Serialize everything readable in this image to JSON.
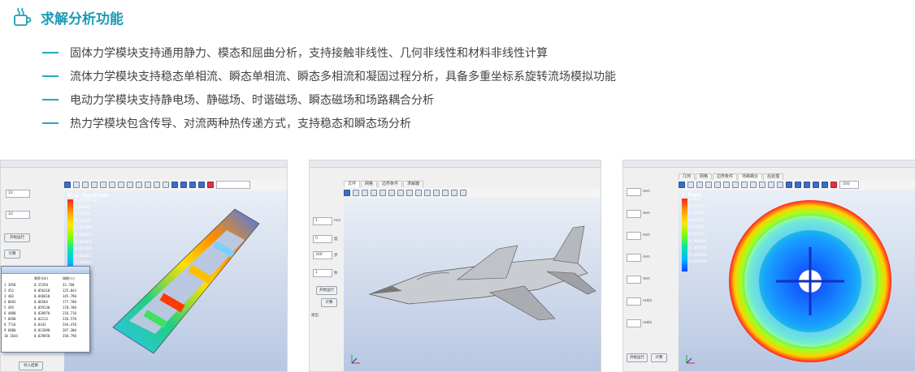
{
  "section": {
    "icon": "coffee-cup-icon",
    "title": "求解分析功能",
    "accent_color": "#1a9bb8"
  },
  "features": [
    "固体力学模块支持通用静力、模态和屈曲分析，支持接触非线性、几何非线性和材料非线性计算",
    "流体力学模块支持稳态单相流、瞬态单相流、瞬态多相流和凝固过程分析，具备多重坐标系旋转流场模拟功能",
    "电动力学模块支持静电场、静磁场、时谐磁场、瞬态磁场和场路耦合分析",
    "热力学模块包含传导、对流两种热传递方式，支持稳态和瞬态场分析"
  ],
  "screenshots": {
    "solid": {
      "viewport_title": "Disp Magnitude",
      "legend_values": [
        "0.02579+02",
        "0.04941",
        "0.11229",
        "0.13469",
        "0.087909",
        "0.066322",
        "0.044435",
        "0.021868",
        "0.000017",
        "0.010001",
        "0.000000"
      ],
      "left_values": [
        "10",
        "10"
      ],
      "buttons": [
        "开始运行",
        "计算"
      ],
      "bottom_button": "导入结果",
      "dialog_header": [
        "频率(Hz)",
        "周期(s)"
      ],
      "dialog_rows": [
        [
          "1  3958",
          "0.25350",
          "33.760"
        ],
        [
          "2  451",
          "0.056310",
          "125.043"
        ],
        [
          "3  402",
          "0.040610",
          "145.790"
        ],
        [
          "4  8693",
          "0.06504",
          "177.700"
        ],
        [
          "5  495",
          "0.059130",
          "178.700"
        ],
        [
          "6  4880",
          "0.020970",
          "216.710"
        ],
        [
          "7  6690",
          "0.02113",
          "226.570"
        ],
        [
          "8  7716",
          "0.0343",
          "244.470"
        ],
        [
          "9  6880",
          "0.012090",
          "287.300"
        ],
        [
          "10 2644",
          "0.029850",
          "358.790"
        ]
      ]
    },
    "fluid": {
      "tabs": [
        "文件",
        "网格",
        "边界条件",
        "求解器"
      ],
      "units": [
        "m/s",
        "度",
        "步",
        "秒"
      ],
      "field_values": [
        "1",
        "0",
        "300",
        "1"
      ],
      "buttons": [
        "开始运行",
        "计算"
      ],
      "bottom_label": "退出"
    },
    "em": {
      "tabs": [
        "几何",
        "网格",
        "边界条件",
        "场路耦合",
        "后处理"
      ],
      "viewport_title": "B Magni",
      "legend_values": [
        "0.025",
        "0.02227",
        "0.01952",
        "0.01678",
        "0.01403",
        "0.01129",
        "0.008545",
        "0.005800",
        "0.003055",
        "0.000310"
      ],
      "zoom_value": "500",
      "units": [
        "mm",
        "mm",
        "mm",
        "mm",
        "mm",
        "rad/s",
        "rad/s"
      ],
      "buttons": [
        "开始运行",
        "计算"
      ]
    }
  }
}
